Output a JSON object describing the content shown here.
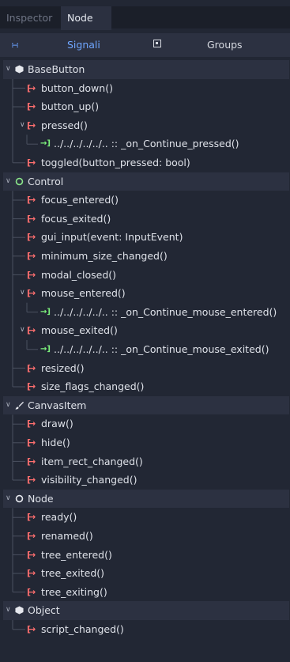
{
  "tabs": {
    "inspector": "Inspector",
    "node": "Node"
  },
  "subbar": {
    "signals": "Signali",
    "groups": "Groups"
  },
  "tree": [
    {
      "kind": "cat",
      "label": "BaseButton",
      "icon": "object-icon"
    },
    {
      "kind": "signal",
      "label": "button_down()"
    },
    {
      "kind": "signal",
      "label": "button_up()"
    },
    {
      "kind": "signal",
      "label": "pressed()",
      "expanded": true
    },
    {
      "kind": "conn",
      "label": "../../../../../.. :: _on_Continue_pressed()"
    },
    {
      "kind": "signal",
      "label": "toggled(button_pressed: bool)"
    },
    {
      "kind": "cat",
      "label": "Control",
      "icon": "control-icon"
    },
    {
      "kind": "signal",
      "label": "focus_entered()"
    },
    {
      "kind": "signal",
      "label": "focus_exited()"
    },
    {
      "kind": "signal",
      "label": "gui_input(event: InputEvent)"
    },
    {
      "kind": "signal",
      "label": "minimum_size_changed()"
    },
    {
      "kind": "signal",
      "label": "modal_closed()"
    },
    {
      "kind": "signal",
      "label": "mouse_entered()",
      "expanded": true
    },
    {
      "kind": "conn",
      "label": "../../../../../.. :: _on_Continue_mouse_entered()"
    },
    {
      "kind": "signal",
      "label": "mouse_exited()",
      "expanded": true
    },
    {
      "kind": "conn",
      "label": "../../../../../.. :: _on_Continue_mouse_exited()"
    },
    {
      "kind": "signal",
      "label": "resized()"
    },
    {
      "kind": "signal",
      "label": "size_flags_changed()"
    },
    {
      "kind": "cat",
      "label": "CanvasItem",
      "icon": "brush-icon"
    },
    {
      "kind": "signal",
      "label": "draw()"
    },
    {
      "kind": "signal",
      "label": "hide()"
    },
    {
      "kind": "signal",
      "label": "item_rect_changed()"
    },
    {
      "kind": "signal",
      "label": "visibility_changed()"
    },
    {
      "kind": "cat",
      "label": "Node",
      "icon": "node-icon"
    },
    {
      "kind": "signal",
      "label": "ready()"
    },
    {
      "kind": "signal",
      "label": "renamed()"
    },
    {
      "kind": "signal",
      "label": "tree_entered()"
    },
    {
      "kind": "signal",
      "label": "tree_exited()"
    },
    {
      "kind": "signal",
      "label": "tree_exiting()"
    },
    {
      "kind": "cat",
      "label": "Object",
      "icon": "object-icon"
    },
    {
      "kind": "signal",
      "label": "script_changed()"
    }
  ]
}
